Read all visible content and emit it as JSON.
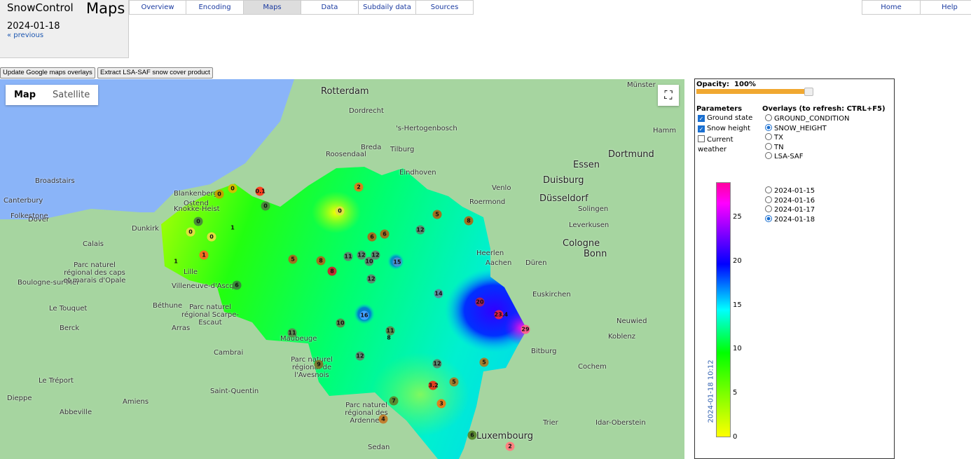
{
  "header": {
    "app": "SnowControl",
    "title": "Maps",
    "date": "2024-01-18",
    "previous": "« previous"
  },
  "tabs": [
    "Overview",
    "Encoding",
    "Maps",
    "Data",
    "Subdaily data",
    "Sources"
  ],
  "active_tab": "Maps",
  "right_tabs": [
    "Home",
    "Help"
  ],
  "buttons": {
    "update": "Update Google maps overlays",
    "extract": "Extract LSA-SAF snow cover product"
  },
  "map": {
    "types": [
      "Map",
      "Satellite"
    ],
    "selected_type": "Map",
    "fullscreen_icon": "fullscreen-icon",
    "labels": [
      "Rotterdam",
      "Dordrecht",
      "'s-Hertogenbosch",
      "Breda",
      "Tilburg",
      "Roosendaal",
      "Eindhoven",
      "Venlo",
      "Roermond",
      "Essen",
      "Duisburg",
      "Düsseldorf",
      "Dortmund",
      "Hamm",
      "Solingen",
      "Leverkusen",
      "Cologne",
      "Bonn",
      "Düren",
      "Aachen",
      "Heerlen",
      "Euskirchen",
      "Koblenz",
      "Neuwied",
      "Cochem",
      "Bitburg",
      "Trier",
      "Idar-Oberstein",
      "Luxembourg",
      "Sedan",
      "Parc naturel régional des Ardennes",
      "Maubeuge",
      "Parc naturel régional de l'Avesnois",
      "Parc naturel régional Scarpe-Escaut",
      "Lille",
      "Villeneuve-d'Ascq",
      "Béthune",
      "Arras",
      "Cambrai",
      "Saint-Quentin",
      "Amiens",
      "Abbeville",
      "Le Tréport",
      "Dieppe",
      "Berck",
      "Le Touquet",
      "Boulogne-sur-Mer",
      "Parc naturel régional des caps et marais d'Opale",
      "Calais",
      "Dunkirk",
      "Folkestone",
      "Dover",
      "Canterbury",
      "Broadstairs",
      "Knokke-Heist",
      "Blankenberge",
      "Ostend",
      "Münster"
    ],
    "stations": [
      "0",
      "0",
      "0.1",
      "0",
      "2",
      "0",
      "0",
      "0",
      "1",
      "0",
      "1",
      "1",
      "5",
      "8",
      "8",
      "6",
      "6",
      "12",
      "11",
      "12",
      "12",
      "10",
      "15",
      "12",
      "5",
      "8",
      "12",
      "6",
      "14",
      "20",
      "23.4",
      "29",
      "16",
      "10",
      "11",
      "8",
      "11",
      "12",
      "9",
      "5",
      "3.2",
      "5",
      "3",
      "7",
      "4",
      "6",
      "2"
    ]
  },
  "panel": {
    "opacity_label": "Opacity:",
    "opacity_value": "100%",
    "opacity": 1.0,
    "parameters_title": "Parameters",
    "parameters": [
      {
        "label": "Ground state",
        "checked": true
      },
      {
        "label": "Snow height",
        "checked": true
      },
      {
        "label": "Current weather",
        "checked": false
      }
    ],
    "overlays_title": "Overlays (to refresh: CTRL+F5)",
    "overlays": [
      "GROUND_CONDITION",
      "SNOW_HEIGHT",
      "TX",
      "TN",
      "LSA-SAF"
    ],
    "selected_overlay": "SNOW_HEIGHT",
    "dates": [
      "2024-01-15",
      "2024-01-16",
      "2024-01-17",
      "2024-01-18"
    ],
    "selected_date": "2024-01-18",
    "colorbar": {
      "ticks": [
        "0",
        "5",
        "10",
        "15",
        "20",
        "25"
      ],
      "timestamp": "2024-01-18 10:12",
      "colors": [
        "#ffff00",
        "#00ff00",
        "#00ffff",
        "#0000ff",
        "#ff00ff"
      ]
    }
  }
}
